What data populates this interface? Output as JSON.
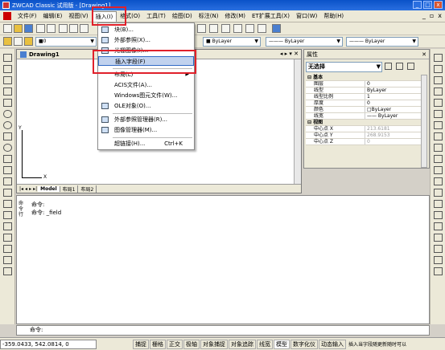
{
  "window": {
    "title": "ZWCAD Classic 试用版 - [Drawing1]"
  },
  "menubar": {
    "items": [
      "文件(F)",
      "编辑(E)",
      "视图(V)",
      "插入(I)",
      "格式(O)",
      "工具(T)",
      "绘图(D)",
      "标注(N)",
      "修改(M)",
      "ET扩展工具(X)",
      "窗口(W)",
      "帮助(H)"
    ],
    "active_index": 3,
    "right_controls": [
      "_",
      "▫",
      "x"
    ]
  },
  "toolbar": {
    "layer_combo": "■0",
    "color_combo": "■ ByLayer",
    "linetype_combo": "——— ByLayer",
    "lineweight_combo": "——— ByLayer"
  },
  "insert_menu": {
    "items": [
      {
        "label": "块(B)...",
        "shortcut": "",
        "submenu": false,
        "icon": "block-icon"
      },
      {
        "label": "外部参照(X)...",
        "shortcut": "",
        "submenu": false,
        "icon": "xref-icon"
      },
      {
        "label": "光栅图像(I)...",
        "shortcut": "",
        "submenu": false,
        "icon": "image-icon"
      },
      {
        "label": "插入字段(F)",
        "shortcut": "",
        "submenu": false,
        "icon": ""
      },
      {
        "label": "布局(L)",
        "shortcut": "",
        "submenu": true,
        "icon": ""
      },
      {
        "label": "ACIS文件(A)...",
        "shortcut": "",
        "submenu": false,
        "icon": ""
      },
      {
        "label": "Windows图元文件(W)...",
        "shortcut": "",
        "submenu": false,
        "icon": ""
      },
      {
        "label": "OLE对象(O)...",
        "shortcut": "",
        "submenu": false,
        "icon": "ole-icon"
      },
      {
        "label": "外部参照管理器(R)...",
        "shortcut": "",
        "submenu": false,
        "icon": "xref-manager-icon"
      },
      {
        "label": "图像管理器(M)...",
        "shortcut": "",
        "submenu": false,
        "icon": "image-manager-icon"
      },
      {
        "label": "超链接(H)...",
        "shortcut": "Ctrl+K",
        "submenu": false,
        "icon": ""
      }
    ],
    "highlighted_index": 3
  },
  "drawing": {
    "tab_title": "Drawing1",
    "tabs": [
      "Model",
      "布局1",
      "布局2"
    ],
    "ucs_y": "Y",
    "ucs_x": "X"
  },
  "properties": {
    "title": "属性",
    "selection": "无选择",
    "rows": [
      {
        "key": "基本",
        "value": "",
        "section": true
      },
      {
        "key": "图层",
        "value": "0"
      },
      {
        "key": "线型",
        "value": "ByLayer"
      },
      {
        "key": "线型比例",
        "value": "1"
      },
      {
        "key": "厚度",
        "value": "0"
      },
      {
        "key": "颜色",
        "value": "□ByLayer"
      },
      {
        "key": "线宽",
        "value": "—— ByLayer"
      },
      {
        "key": "视图",
        "value": "",
        "section": true
      },
      {
        "key": "中心点 X",
        "value": "213.6181",
        "dim": true
      },
      {
        "key": "中心点 Y",
        "value": "268.9153",
        "dim": true
      },
      {
        "key": "中心点 Z",
        "value": "0",
        "dim": true
      }
    ]
  },
  "command": {
    "side_label": "命令行",
    "lines": [
      "命令:",
      "命令: _field"
    ],
    "prompt": "命令:"
  },
  "status": {
    "coords": "-359.0433,  542.0814,  0",
    "buttons": [
      "捕捉",
      "栅格",
      "正交",
      "极轴",
      "对象捕捉",
      "对象追踪",
      "线宽",
      "模型",
      "数字化仪",
      "动态输入"
    ],
    "message": "插入当字段随更新随时可以",
    "on_buttons": [
      "模型"
    ]
  }
}
